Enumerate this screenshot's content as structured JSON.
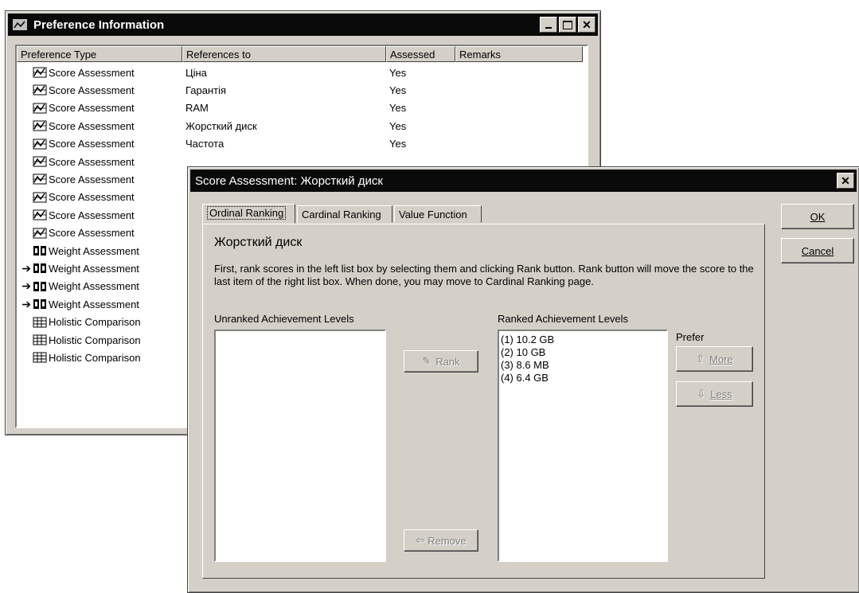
{
  "pref_window": {
    "title": "Preference Information",
    "columns": [
      "Preference Type",
      "References to",
      "Assessed",
      "Remarks"
    ],
    "rows": [
      {
        "arrow": "",
        "icon": "score-icon",
        "type": "Score Assessment",
        "ref": "Ціна",
        "assessed": "Yes"
      },
      {
        "arrow": "",
        "icon": "score-icon",
        "type": "Score Assessment",
        "ref": "Гарантія",
        "assessed": "Yes"
      },
      {
        "arrow": "",
        "icon": "score-icon",
        "type": "Score Assessment",
        "ref": "RAM",
        "assessed": "Yes"
      },
      {
        "arrow": "",
        "icon": "score-icon",
        "type": "Score Assessment",
        "ref": "Жорсткий диск",
        "assessed": "Yes"
      },
      {
        "arrow": "",
        "icon": "score-icon",
        "type": "Score Assessment",
        "ref": "Частота",
        "assessed": "Yes"
      },
      {
        "arrow": "",
        "icon": "score-icon",
        "type": "Score Assessment",
        "ref": "",
        "assessed": ""
      },
      {
        "arrow": "",
        "icon": "score-icon",
        "type": "Score Assessment",
        "ref": "",
        "assessed": ""
      },
      {
        "arrow": "",
        "icon": "score-icon",
        "type": "Score Assessment",
        "ref": "",
        "assessed": ""
      },
      {
        "arrow": "",
        "icon": "score-icon",
        "type": "Score Assessment",
        "ref": "",
        "assessed": ""
      },
      {
        "arrow": "",
        "icon": "score-icon",
        "type": "Score Assessment",
        "ref": "",
        "assessed": ""
      },
      {
        "arrow": "",
        "icon": "weight-icon",
        "type": "Weight Assessment",
        "ref": "",
        "assessed": ""
      },
      {
        "arrow": "➔",
        "icon": "weight-icon",
        "type": "Weight Assessment",
        "ref": "",
        "assessed": ""
      },
      {
        "arrow": "➔",
        "icon": "weight-icon",
        "type": "Weight Assessment",
        "ref": "",
        "assessed": ""
      },
      {
        "arrow": "➔",
        "icon": "weight-icon",
        "type": "Weight Assessment",
        "ref": "",
        "assessed": ""
      },
      {
        "arrow": "",
        "icon": "holistic-icon",
        "type": "Holistic Comparison",
        "ref": "",
        "assessed": ""
      },
      {
        "arrow": "",
        "icon": "holistic-icon",
        "type": "Holistic Comparison",
        "ref": "",
        "assessed": ""
      },
      {
        "arrow": "",
        "icon": "holistic-icon",
        "type": "Holistic Comparison",
        "ref": "",
        "assessed": ""
      }
    ]
  },
  "dialog": {
    "title": "Score Assessment: Жорсткий диск",
    "tabs": [
      "Ordinal Ranking",
      "Cardinal Ranking",
      "Value Function"
    ],
    "heading": "Жорсткий диск",
    "instructions": "First, rank scores in the left list box by selecting them and clicking Rank button. Rank button will move the score to the last item of the right list box. When done, you may move to Cardinal Ranking page.",
    "unranked_label": "Unranked Achievement Levels",
    "ranked_label": "Ranked Achievement Levels",
    "prefer_label": "Prefer",
    "ranked_items": [
      "(1) 10.2 GB",
      "(2) 10 GB",
      "(3) 8.6 MB",
      "(4) 6.4 GB"
    ],
    "rank_button": "Rank",
    "remove_button": "Remove",
    "more_button": "More",
    "less_button": "Less",
    "ok_button": "OK",
    "cancel_button": "Cancel",
    "close_glyph": "✕"
  }
}
